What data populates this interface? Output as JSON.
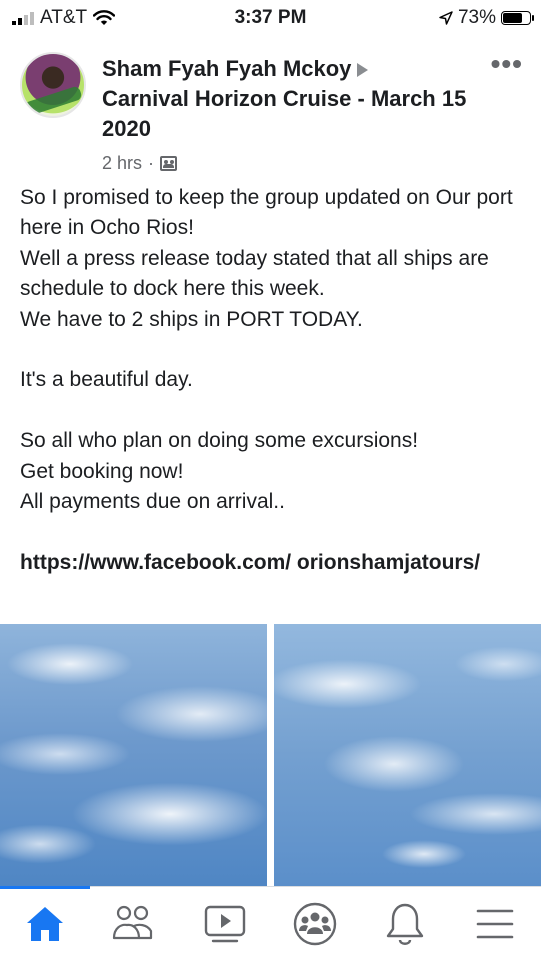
{
  "status_bar": {
    "carrier": "AT&T",
    "time": "3:37 PM",
    "battery": "73%",
    "battery_level": 0.73
  },
  "post": {
    "author": "Sham Fyah Fyah Mckoy",
    "group": "Carnival Horizon Cruise - March 15 2020",
    "time_ago": "2 hrs",
    "dot": "·",
    "more": "•••",
    "paragraphs": [
      "So I promised to keep the group updated on Our port here in Ocho Rios!",
      "Well a press release today stated that all ships are schedule to dock here this week.",
      "We have to 2 ships in PORT TODAY.",
      "It's a beautiful day.",
      "So all who plan on doing some excursions!",
      "Get booking now!",
      "All payments due on arrival..",
      "https://www.facebook.com/ orionshamjatours/"
    ]
  },
  "colors": {
    "accent": "#1877f2",
    "icon_gray": "#65676b"
  },
  "icons": {
    "nav": [
      "home-icon",
      "friends-icon",
      "watch-icon",
      "groups-icon",
      "notifications-icon",
      "menu-icon"
    ]
  }
}
